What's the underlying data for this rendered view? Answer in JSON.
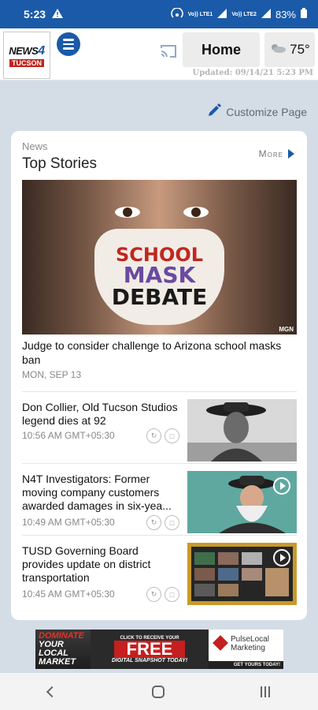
{
  "status_bar": {
    "time": "5:23",
    "network_label_1": "Vo)) LTE1",
    "network_label_2": "Vo)) LTE2",
    "battery": "83%"
  },
  "header": {
    "logo_line1": "NEWS",
    "logo_num": "4",
    "logo_line2": "TUCSON",
    "home_label": "Home",
    "temperature": "75°",
    "updated": "Updated: 09/14/21 5:23 PM",
    "icons": {
      "menu": "menu-icon",
      "cast": "cast-icon",
      "weather": "partly-cloudy-icon"
    }
  },
  "customize_label": "Customize Page",
  "section": {
    "category": "News",
    "title": "Top Stories",
    "more_label": "More"
  },
  "lead_story": {
    "headline": "Judge to consider challenge to Arizona school masks ban",
    "date": "MON, SEP 13",
    "image_text": [
      "SCHOOL",
      "MASK",
      "DEBATE"
    ],
    "image_credit": "MGN"
  },
  "stories": [
    {
      "headline": "Don Collier, Old Tucson Studios legend dies at 92",
      "time": "10:56 AM GMT+05:30",
      "has_video": false
    },
    {
      "headline": "N4T Investigators: Former moving company customers awarded damages in six-yea...",
      "time": "10:49 AM GMT+05:30",
      "has_video": true
    },
    {
      "headline": "TUSD Governing Board provides update on district transportation",
      "time": "10:45 AM GMT+05:30",
      "has_video": true
    }
  ],
  "ad": {
    "left_lines": [
      "DOMINATE",
      "YOUR",
      "LOCAL",
      "MARKET"
    ],
    "small": "CLICK TO RECEIVE YOUR",
    "big": "FREE",
    "sub": "DIGITAL SNAPSHOT TODAY!",
    "brand_line1": "PulseLocal",
    "brand_line2": "Marketing",
    "cta": "GET YOURS TODAY!"
  },
  "colors": {
    "brand_blue": "#1a5aa8",
    "background": "#d4dde6",
    "red": "#c1271f"
  }
}
